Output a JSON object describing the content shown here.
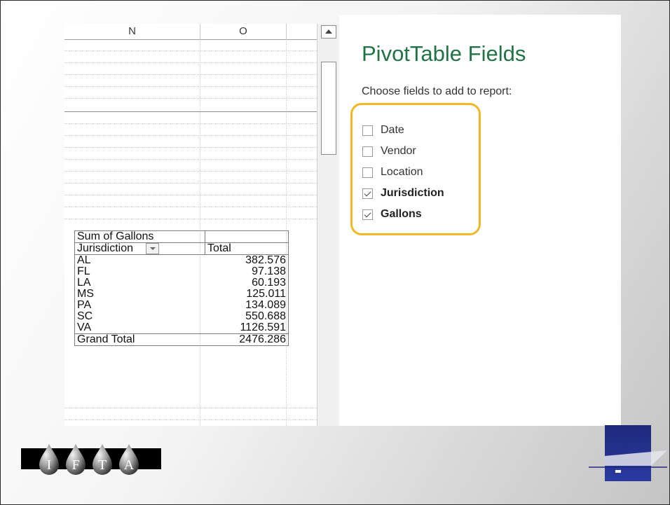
{
  "sheet": {
    "columns": [
      "N",
      "O"
    ],
    "pivot": {
      "title": "Sum of Gallons",
      "row_header": "Jurisdiction",
      "value_header": "Total",
      "rows": [
        {
          "label": "AL",
          "value": "382.576"
        },
        {
          "label": "FL",
          "value": "97.138"
        },
        {
          "label": "LA",
          "value": "60.193"
        },
        {
          "label": "MS",
          "value": "125.011"
        },
        {
          "label": "PA",
          "value": "134.089"
        },
        {
          "label": "SC",
          "value": "550.688"
        },
        {
          "label": "VA",
          "value": "1126.591"
        }
      ],
      "grand_total_label": "Grand Total",
      "grand_total_value": "2476.286"
    }
  },
  "panel": {
    "title": "PivotTable Fields",
    "subtitle": "Choose fields to add to report:",
    "fields": [
      {
        "label": "Date",
        "checked": false
      },
      {
        "label": "Vendor",
        "checked": false
      },
      {
        "label": "Location",
        "checked": false
      },
      {
        "label": "Jurisdiction",
        "checked": true
      },
      {
        "label": "Gallons",
        "checked": true
      }
    ],
    "highlight_color": "#f2b824",
    "title_color": "#217346"
  },
  "logos": {
    "ifta_letters": [
      "I",
      "F",
      "T",
      "A"
    ],
    "corner_logo_color": "#1f2a7c"
  }
}
